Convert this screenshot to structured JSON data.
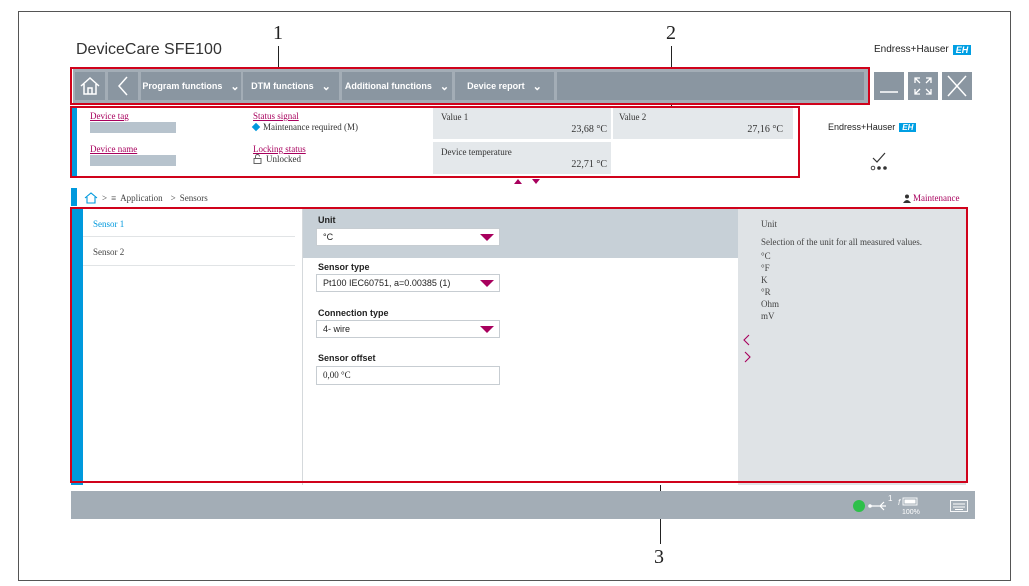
{
  "app": {
    "title": "DeviceCare SFE100",
    "brand": "Endress+Hauser",
    "brand_mark": "EH"
  },
  "callouts": [
    "1",
    "2",
    "3"
  ],
  "toolbar": {
    "program_functions": "Program functions",
    "dtm_functions": "DTM functions",
    "additional_functions": "Additional functions",
    "device_report": "Device report"
  },
  "header": {
    "device_tag_label": "Device tag",
    "device_name_label": "Device name",
    "status_signal_label": "Status signal",
    "status_signal_value": "Maintenance required (M)",
    "locking_status_label": "Locking status",
    "locking_status_value": "Unlocked",
    "value1_label": "Value 1",
    "value1": "23,68 °C",
    "value2_label": "Value 2",
    "value2": "27,16 °C",
    "device_temp_label": "Device temperature",
    "device_temp": "22,71 °C",
    "brand": "Endress+Hauser",
    "brand_mark": "EH"
  },
  "breadcrumb": {
    "sep": ">",
    "application": "Application",
    "sensors": "Sensors",
    "role": "Maintenance"
  },
  "nav": {
    "items": [
      "Sensor 1",
      "Sensor 2"
    ]
  },
  "form": {
    "unit_label": "Unit",
    "unit_value": "°C",
    "sensor_type_label": "Sensor type",
    "sensor_type_value": "Pt100 IEC60751, a=0.00385 (1)",
    "connection_type_label": "Connection type",
    "connection_type_value": "4- wire",
    "sensor_offset_label": "Sensor offset",
    "sensor_offset_value": "0,00 °C"
  },
  "help": {
    "title": "Unit",
    "description": "Selection of the unit for all measured values.",
    "options": [
      "°C",
      "°F",
      "K",
      "°R",
      "Ohm",
      "mV"
    ]
  },
  "statusbar": {
    "usb_count": "1",
    "battery": "100%"
  },
  "colors": {
    "accent": "#a8005d",
    "nav_blue": "#0099dd",
    "brand_blue": "#009fe3",
    "status_green": "#2ec04a",
    "frame_red": "#d0021b"
  }
}
